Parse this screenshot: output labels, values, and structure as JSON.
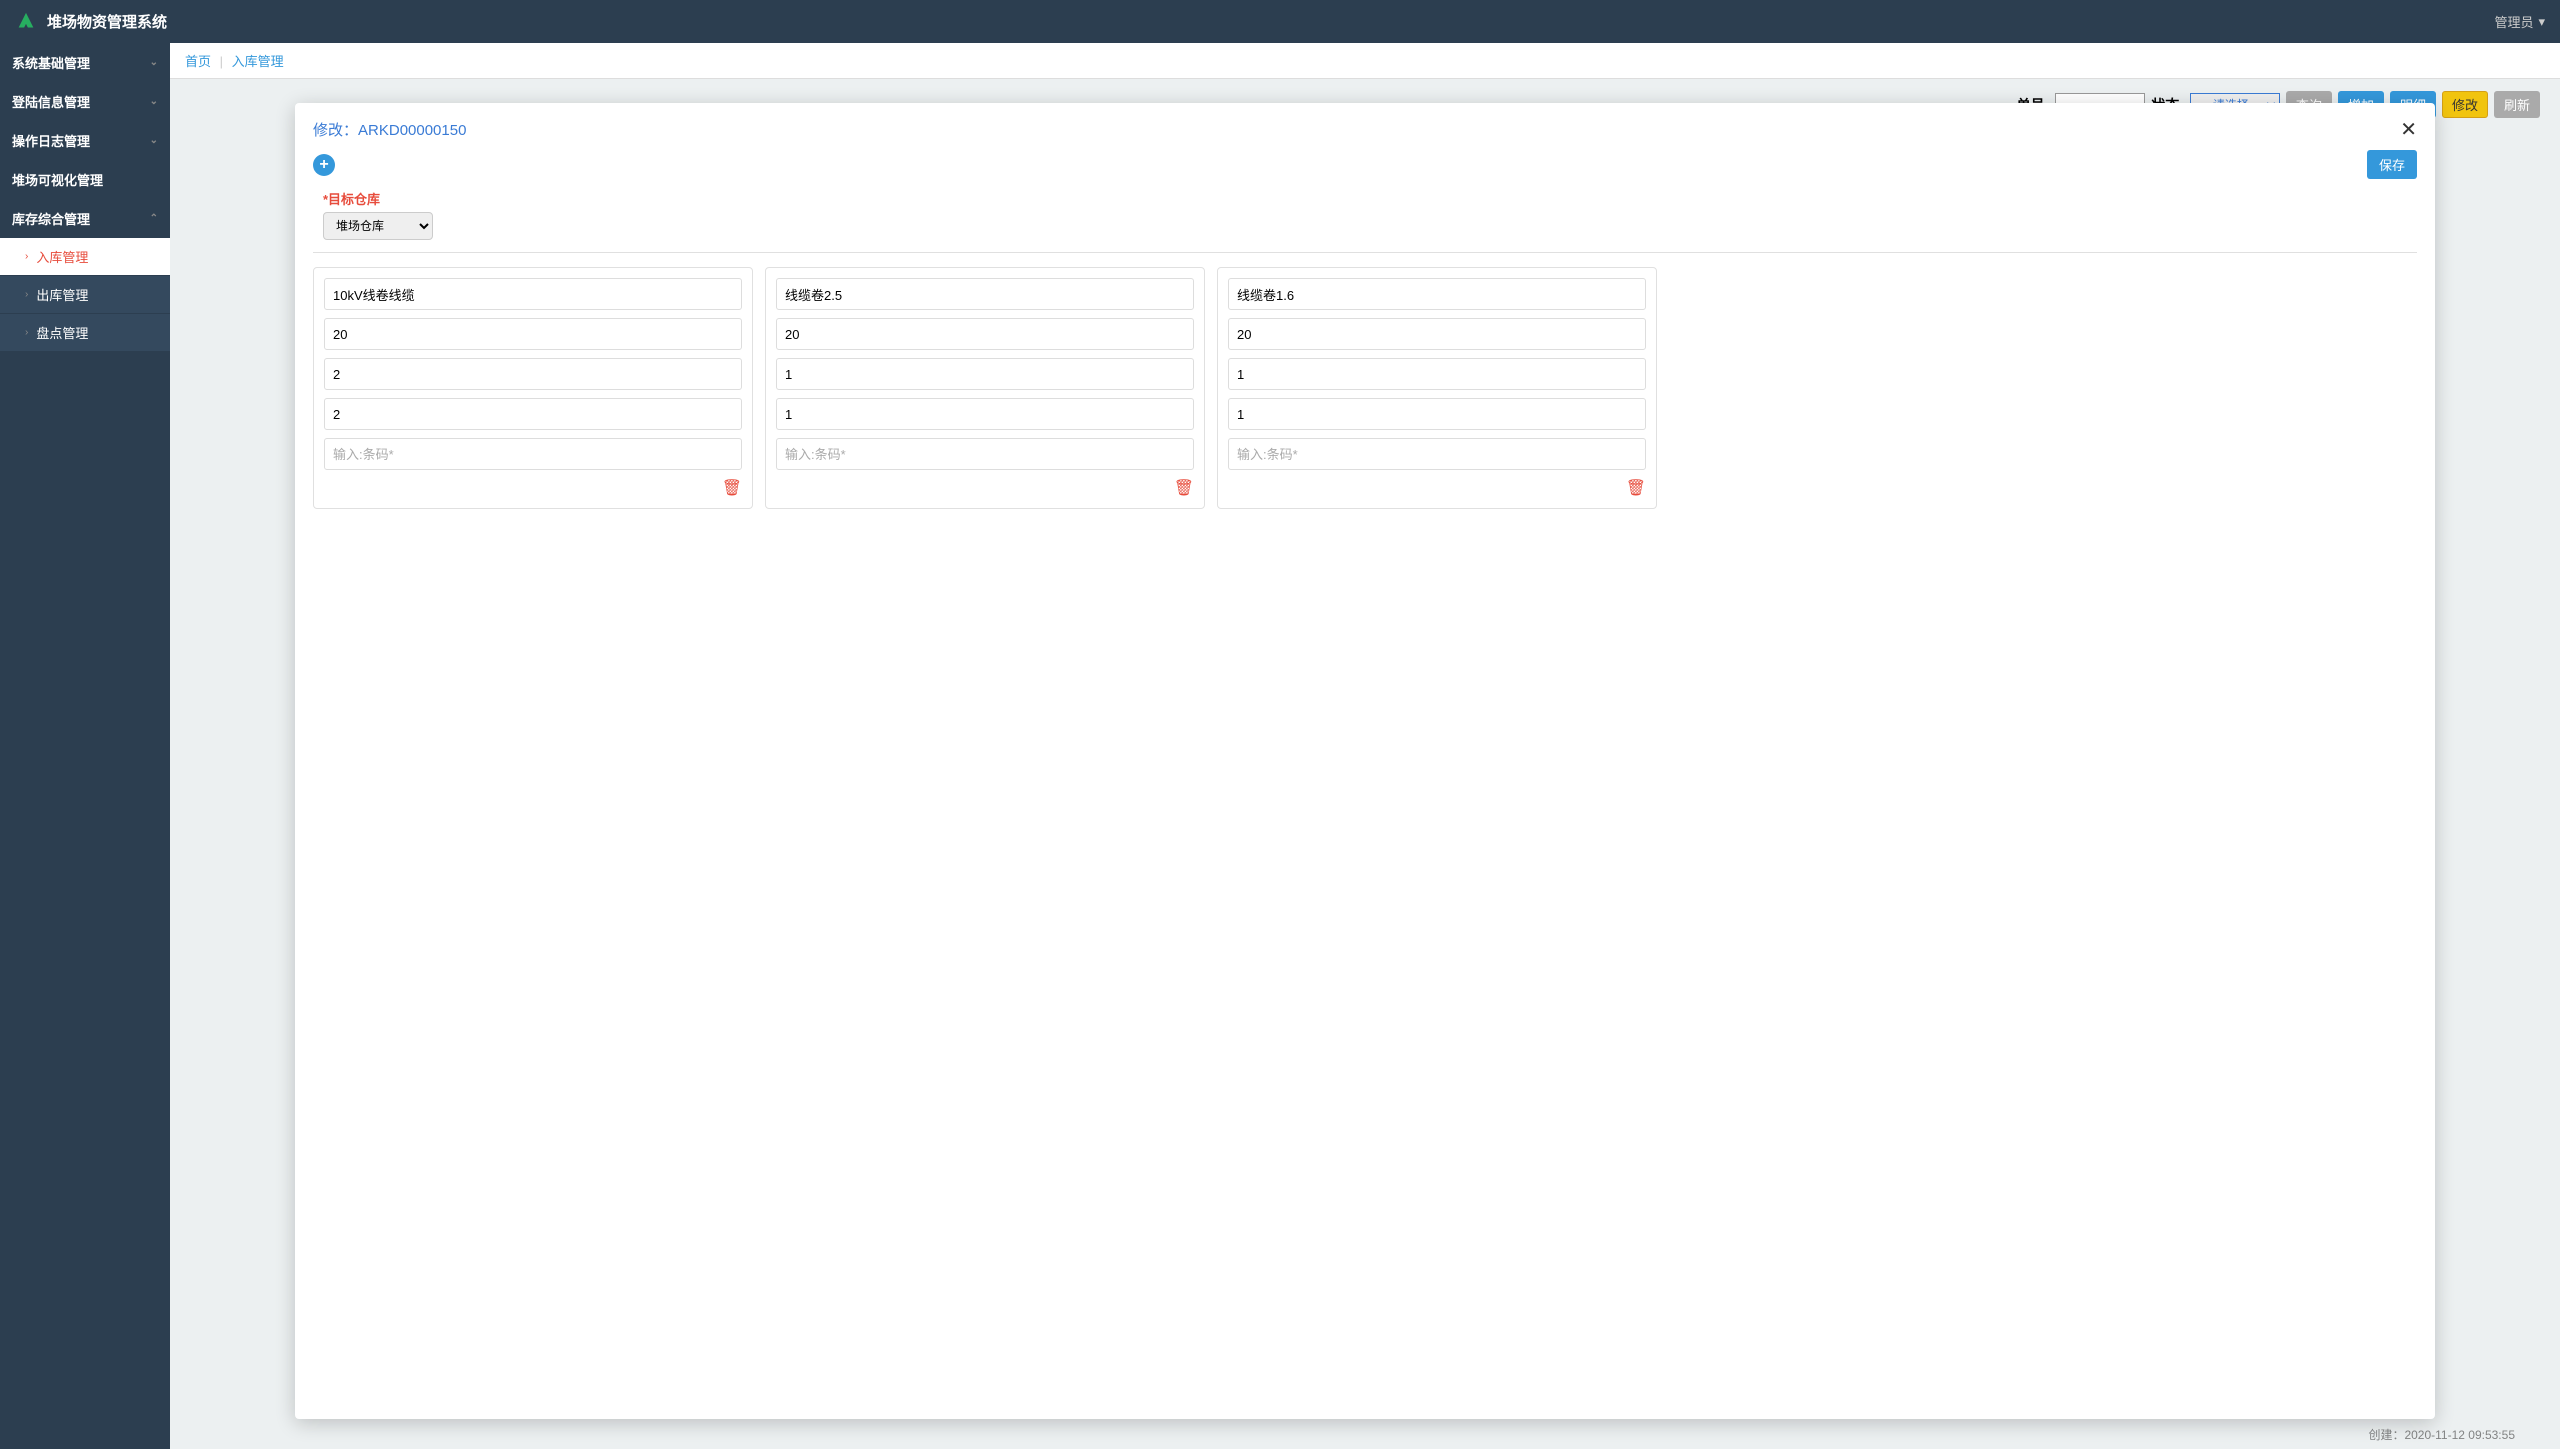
{
  "header": {
    "app_title": "堆场物资管理系统",
    "user_label": "管理员"
  },
  "sidebar": {
    "menu": [
      {
        "label": "系统基础管理",
        "expanded": false
      },
      {
        "label": "登陆信息管理",
        "expanded": false
      },
      {
        "label": "操作日志管理",
        "expanded": false
      },
      {
        "label": "堆场可视化管理",
        "expanded": null
      },
      {
        "label": "库存综合管理",
        "expanded": true
      }
    ],
    "submenu": [
      {
        "label": "入库管理",
        "active": true
      },
      {
        "label": "出库管理",
        "active": false
      },
      {
        "label": "盘点管理",
        "active": false
      }
    ]
  },
  "breadcrumb": {
    "home": "首页",
    "current": "入库管理"
  },
  "toolbar": {
    "order_label": "单号:",
    "status_label": "状态:",
    "status_placeholder": "----请选择----",
    "query": "查询",
    "add": "增加",
    "detail": "明细",
    "edit": "修改",
    "refresh": "刷新"
  },
  "modal": {
    "title_prefix": "修改：",
    "record_id": "ARKD00000150",
    "save": "保存",
    "target_label": "*目标仓库",
    "target_value": "堆场仓库",
    "barcode_placeholder": "输入:条码*",
    "cards": [
      {
        "name": "10kV线卷线缆",
        "f2": "20",
        "f3": "2",
        "f4": "2"
      },
      {
        "name": "线缆卷2.5",
        "f2": "20",
        "f3": "1",
        "f4": "1"
      },
      {
        "name": "线缆卷1.6",
        "f2": "20",
        "f3": "1",
        "f4": "1"
      }
    ]
  },
  "bg_footer": {
    "created_prefix": "创建：",
    "created_value": "2020-11-12 09:53:55"
  }
}
